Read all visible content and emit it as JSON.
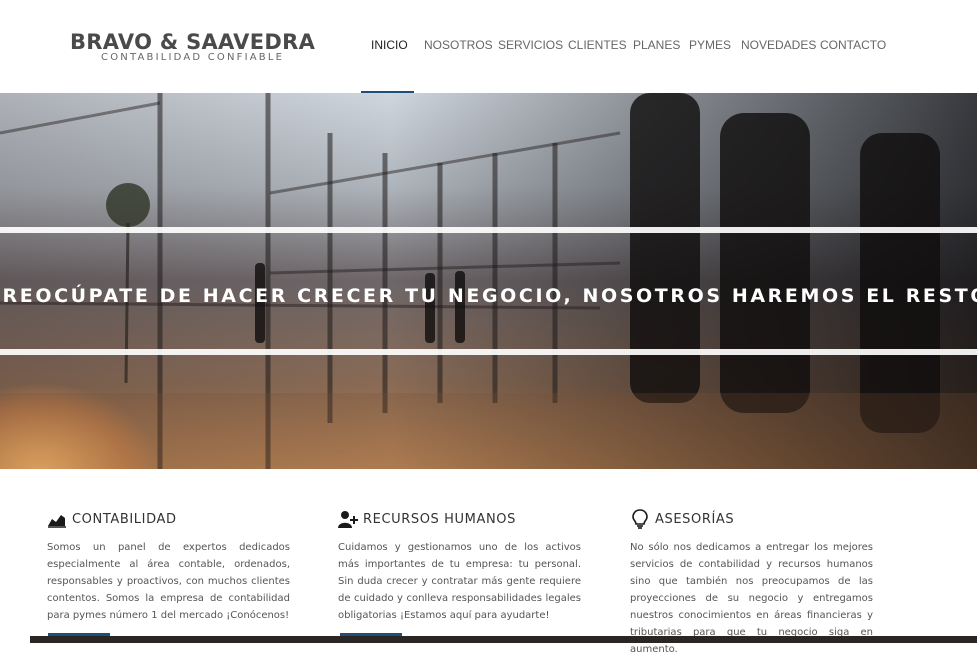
{
  "brand": {
    "name": "BRAVO & SAAVEDRA",
    "tagline": "CONTABILIDAD CONFIABLE"
  },
  "nav": {
    "items": [
      {
        "label": "INICIO",
        "active": true
      },
      {
        "label": "NOSOTROS"
      },
      {
        "label": "SERVICIOS"
      },
      {
        "label": "CLIENTES"
      },
      {
        "label": "PLANES"
      },
      {
        "label": "PYMES"
      },
      {
        "label": "NOVEDADES"
      },
      {
        "label": "CONTACTO"
      }
    ]
  },
  "hero": {
    "slogan": "PREOCÚPATE DE HACER CRECER TU NEGOCIO, NOSOTROS HAREMOS EL RESTO"
  },
  "services": [
    {
      "icon": "area-chart-icon",
      "title": "CONTABILIDAD",
      "text": "Somos un panel de expertos dedicados especialmente al área contable, ordenados, responsables y proactivos, con muchos clientes contentos. Somos la empresa de contabilidad para pymes número 1 del mercado ¡Conócenos!"
    },
    {
      "icon": "add-user-icon",
      "title": "RECURSOS HUMANOS",
      "text": "Cuidamos y gestionamos uno de los activos más importantes de tu empresa: tu personal. Sin duda crecer y contratar más gente requiere de cuidado y conlleva responsabilidades legales obligatorias ¡Estamos aquí para ayudarte!"
    },
    {
      "icon": "lightbulb-icon",
      "title": "ASESORÍAS",
      "text": "No sólo nos dedicamos a entregar los mejores servicios de contabilidad y recursos humanos sino que también nos preocupamos de las proyecciones de su negocio y entregamos nuestros conocimientos en áreas financieras y tributarias para que tu negocio siga en aumento."
    }
  ],
  "colors": {
    "accent": "#1f4e79",
    "text": "#555555",
    "heading": "#333333"
  }
}
